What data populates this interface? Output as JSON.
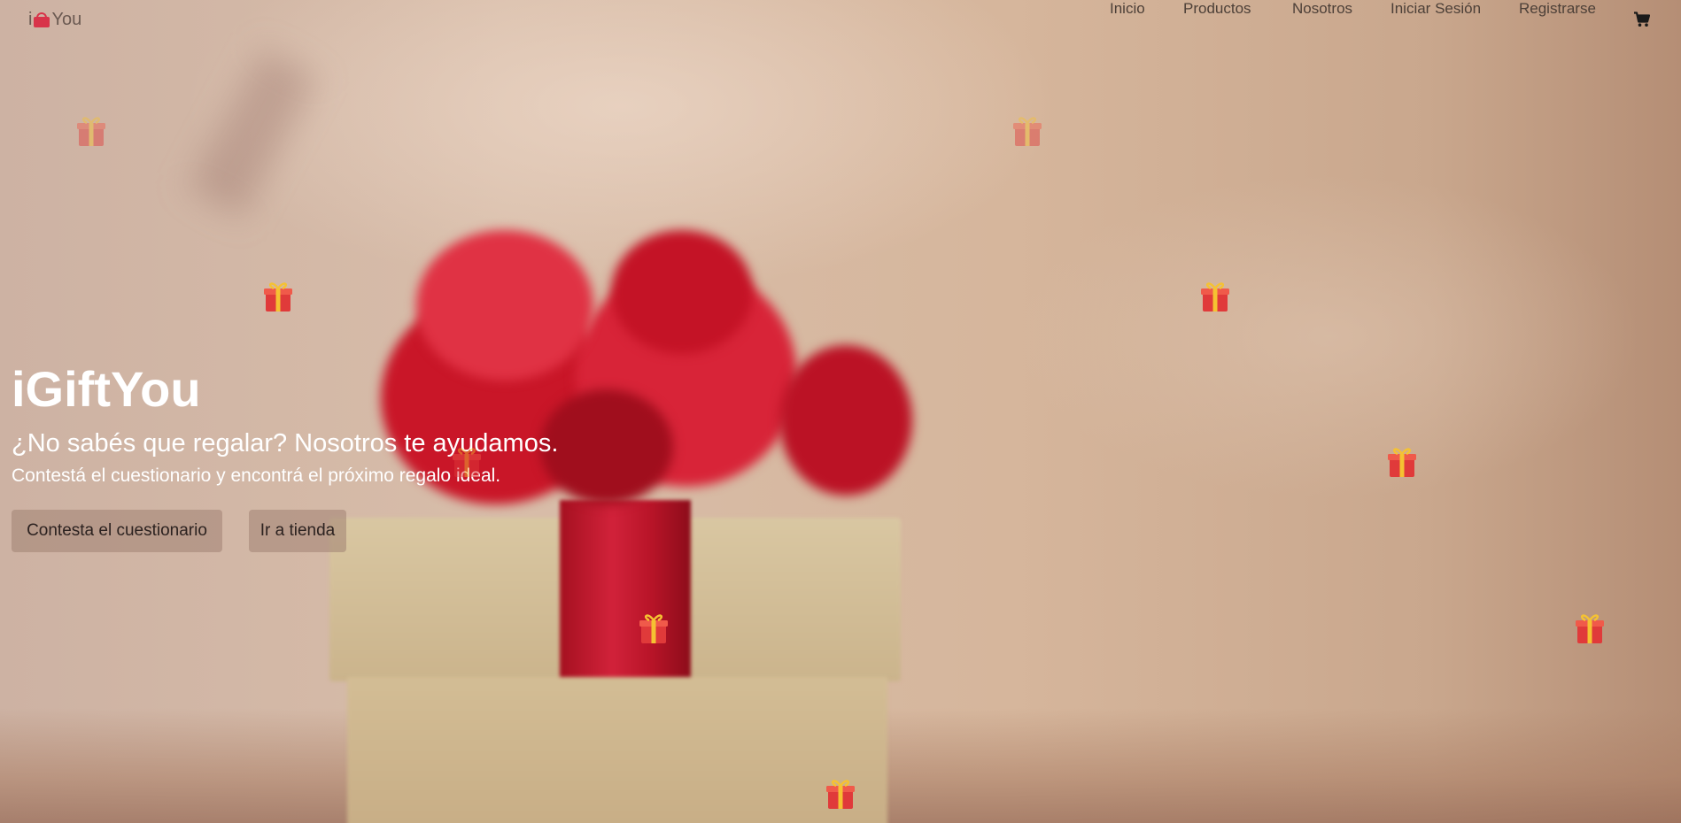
{
  "brand": {
    "prefix": "i",
    "suffix": "You",
    "icon": "gift-icon",
    "color": "#d8344a"
  },
  "nav": {
    "items": [
      {
        "label": "Inicio"
      },
      {
        "label": "Productos"
      },
      {
        "label": "Nosotros"
      },
      {
        "label": "Iniciar Sesión"
      },
      {
        "label": "Registrarse"
      }
    ],
    "cart_icon": "cart-icon"
  },
  "hero": {
    "title": "iGiftYou",
    "subtitle": "¿No sabés que regalar? Nosotros te ayudamos.",
    "text": "Contestá el cuestionario y encontrá el próximo regalo ideal.",
    "buttons": {
      "quiz_label": "Contesta el cuestionario",
      "shop_label": "Ir a tienda"
    },
    "background_image": "gift-box-with-red-bow"
  },
  "decorations": {
    "icon": "gift-icon",
    "count": 10
  }
}
